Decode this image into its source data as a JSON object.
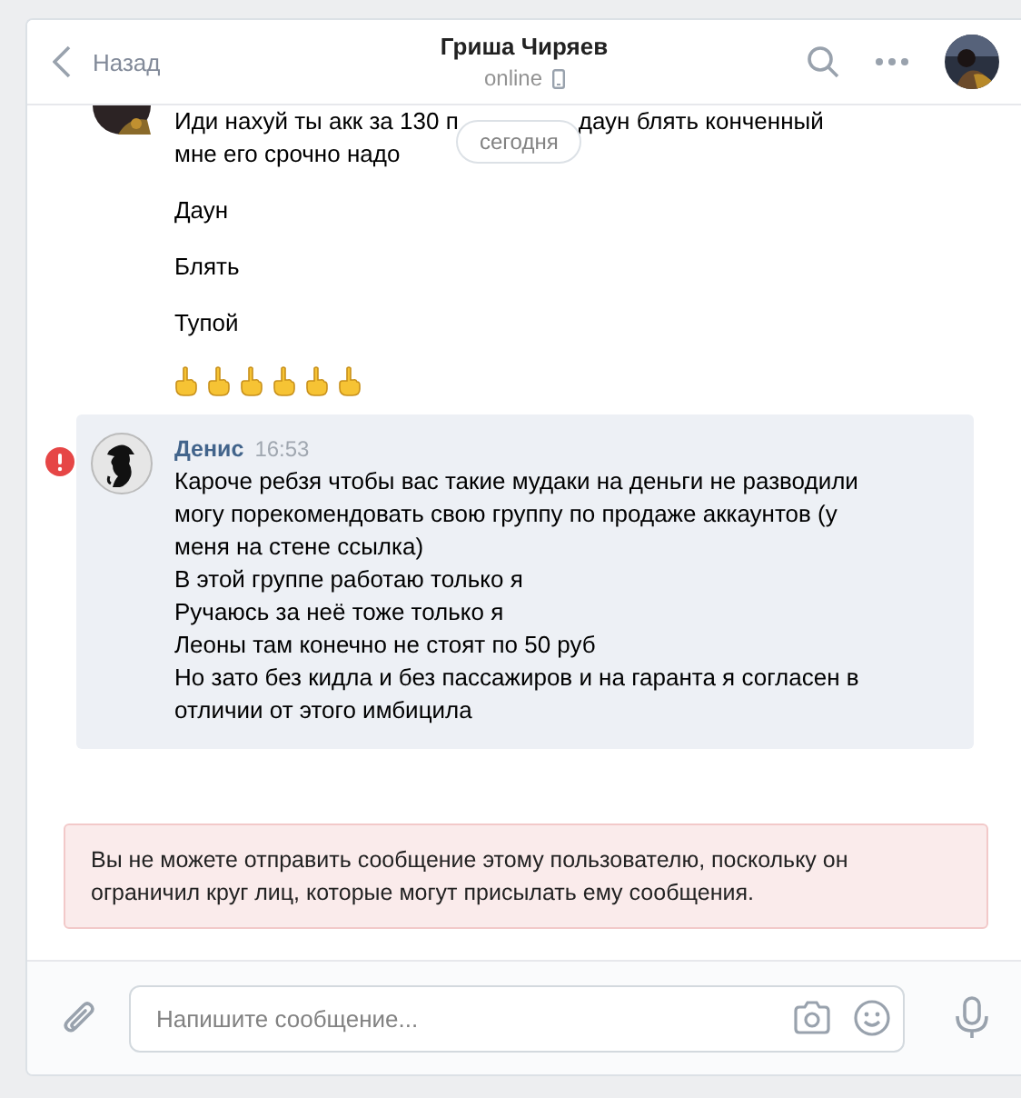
{
  "header": {
    "back": "Назад",
    "title": "Гриша Чиряев",
    "status": "online",
    "mobile": true
  },
  "date_divider": "сегодня",
  "earlier_messages": [
    {
      "kind": "text",
      "lines": [
        [
          "Иди нахуй ты акк за 130 п",
          "даун блять конченный"
        ],
        [
          "мне его срочно надо"
        ]
      ]
    },
    {
      "kind": "text",
      "lines": [
        [
          "Даун"
        ]
      ]
    },
    {
      "kind": "text",
      "lines": [
        [
          "Блять"
        ]
      ]
    },
    {
      "kind": "text",
      "lines": [
        [
          "Тупой"
        ]
      ]
    },
    {
      "kind": "emoji",
      "emoji": [
        {
          "kind": "middle-finger"
        },
        {
          "kind": "middle-finger"
        },
        {
          "kind": "middle-finger"
        },
        {
          "kind": "middle-finger"
        },
        {
          "kind": "middle-finger"
        },
        {
          "kind": "middle-finger"
        }
      ]
    }
  ],
  "message": {
    "author": "Денис",
    "time": "16:53",
    "selected": true,
    "failed": true,
    "lines": [
      "Кароче ребзя чтобы вас такие мудаки на деньги не разводили",
      "могу порекомендовать свою группу по продаже аккаунтов (у",
      "меня на стене ссылка)",
      "В этой группе работаю только я",
      "Ручаюсь за неё тоже только я",
      "Леоны там конечно не стоят по 50 руб",
      "Но зато без кидла и без пассажиров и на гаранта я согласен в",
      "отличии от этого имбицила"
    ]
  },
  "notice": "Вы не можете отправить сообщение этому пользователю, поскольку он ограничил круг лиц, которые могут присылать ему сообщения.",
  "composer": {
    "placeholder": "Напишите сообщение..."
  }
}
